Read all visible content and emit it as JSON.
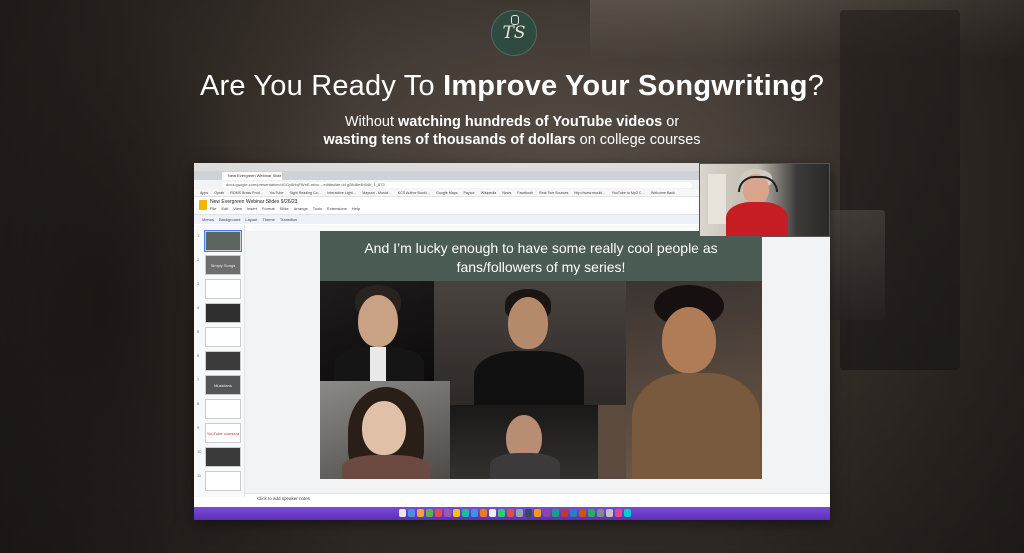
{
  "page": {
    "logo_text": "TS",
    "headline_prefix": "Are You Ready To ",
    "headline_bold": "Improve Your Songwriting",
    "headline_suffix": "?",
    "sub_line1_pre": "Without ",
    "sub_line1_bold": "watching hundreds of YouTube videos",
    "sub_line1_post": " or",
    "sub_line2_bold": "wasting tens of thousands of dollars",
    "sub_line2_post": " on college courses"
  },
  "video": {
    "browser_tab": "New Evergreen Webinar Slide",
    "url": "docs.google.com/presentation/d/1Gy8HqFWnE-mixu…edit#slide=id.g28d8e4b54b_1_873",
    "bookmarks": [
      "Apps",
      "Oprah",
      "ROMS Brass Prod…",
      "YouTube",
      "Sight Reading Ca…",
      "Interactive Light…",
      "Mayson - Musici…",
      "KCS Author Bookl…",
      "Google Maps",
      "Paycor",
      "Wikipedia",
      "News",
      "Facebook",
      "Real Tom Sources",
      "http://www.musici…",
      "YouTube to Mp3 C…",
      "Welcome Back"
    ],
    "doc_title": "New Evergreen Webinar Slides 9/26/23",
    "menus": [
      "File",
      "Edit",
      "View",
      "Insert",
      "Format",
      "Slide",
      "Arrange",
      "Tools",
      "Extensions",
      "Help"
    ],
    "toolbar": [
      "Menus",
      "Background",
      "Layout",
      "Theme",
      "Transition"
    ],
    "slide_heading": "And I’m lucky enough to have some really cool people as fans/followers of my series!",
    "thumb_labels": [
      "",
      "Simply Songs",
      "",
      "",
      "",
      "",
      "Musicians",
      "",
      "YouTube coursera",
      "",
      ""
    ],
    "notes": "Click to add speaker notes",
    "accent_dock": "#6b3fcc",
    "slide_header_color": "#4b5c55"
  }
}
